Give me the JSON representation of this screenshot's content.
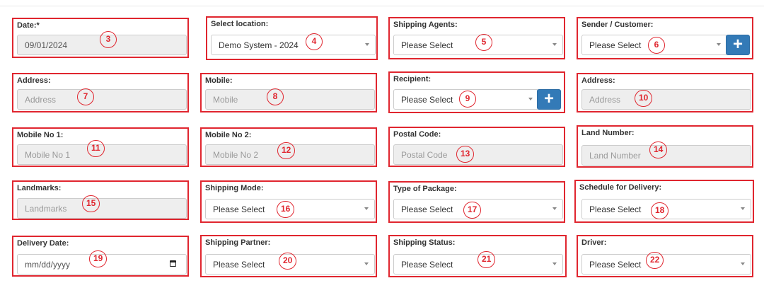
{
  "form": {
    "date": {
      "label": "Date:*",
      "value": "09/01/2024",
      "badge": "3"
    },
    "select_location": {
      "label": "Select location:",
      "value": "Demo System - 2024",
      "badge": "4"
    },
    "shipping_agents": {
      "label": "Shipping Agents:",
      "value": "Please Select",
      "badge": "5"
    },
    "sender_customer": {
      "label": "Sender / Customer:",
      "value": "Please Select",
      "badge": "6",
      "add_label": "+"
    },
    "sender_address": {
      "label": "Address:",
      "placeholder": "Address",
      "badge": "7"
    },
    "mobile": {
      "label": "Mobile:",
      "placeholder": "Mobile",
      "badge": "8"
    },
    "recipient": {
      "label": "Recipient:",
      "value": "Please Select",
      "badge": "9",
      "add_label": "+"
    },
    "recipient_address": {
      "label": "Address:",
      "placeholder": "Address",
      "badge": "10"
    },
    "mobile_no_1": {
      "label": "Mobile No 1:",
      "placeholder": "Mobile No 1",
      "badge": "11"
    },
    "mobile_no_2": {
      "label": "Mobile No 2:",
      "placeholder": "Mobile No 2",
      "badge": "12"
    },
    "postal_code": {
      "label": "Postal Code:",
      "placeholder": "Postal Code",
      "badge": "13"
    },
    "land_number": {
      "label": "Land Number:",
      "placeholder": "Land Number",
      "badge": "14"
    },
    "landmarks": {
      "label": "Landmarks:",
      "placeholder": "Landmarks",
      "badge": "15"
    },
    "shipping_mode": {
      "label": "Shipping Mode:",
      "value": "Please Select",
      "badge": "16"
    },
    "type_of_package": {
      "label": "Type of Package:",
      "value": "Please Select",
      "badge": "17"
    },
    "schedule_for_delivery": {
      "label": "Schedule for Delivery:",
      "value": "Please Select",
      "badge": "18"
    },
    "delivery_date": {
      "label": "Delivery Date:",
      "placeholder": "mm/dd/yyyy",
      "badge": "19"
    },
    "shipping_partner": {
      "label": "Shipping Partner:",
      "value": "Please Select",
      "badge": "20"
    },
    "shipping_status": {
      "label": "Shipping Status:",
      "value": "Please Select",
      "badge": "21"
    },
    "driver": {
      "label": "Driver:",
      "value": "Please Select",
      "badge": "22"
    }
  },
  "icons": {
    "dropdown": "chevron-down-icon",
    "calendar": "calendar-icon",
    "add": "plus-icon"
  },
  "colors": {
    "annotation": "#e0262f",
    "add_button": "#337ab7",
    "readonly_bg": "#eeeeee"
  }
}
